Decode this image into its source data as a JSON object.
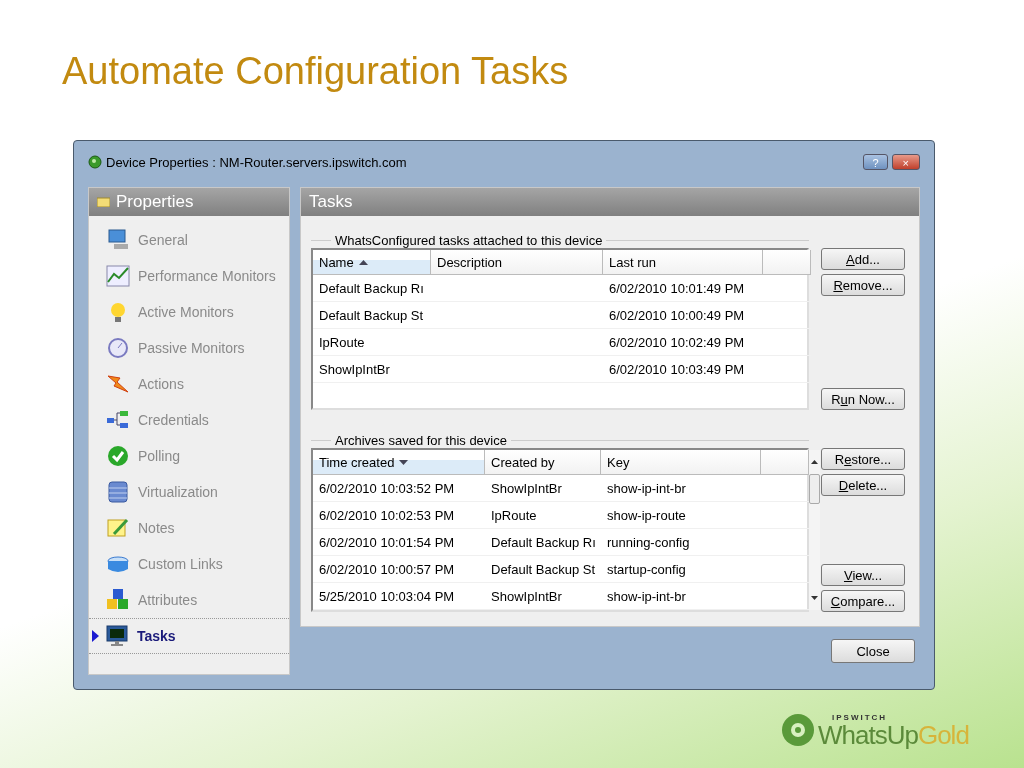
{
  "slide_title": "Automate Configuration Tasks",
  "window": {
    "title": "Device Properties : NM-Router.servers.ipswitch.com",
    "help": "?",
    "close": "×"
  },
  "sidebar": {
    "title": "Properties",
    "items": [
      {
        "label": "General",
        "kind": "computer",
        "selected": false
      },
      {
        "label": "Performance Monitors",
        "kind": "chart",
        "selected": false
      },
      {
        "label": "Active Monitors",
        "kind": "bulb",
        "selected": false
      },
      {
        "label": "Passive Monitors",
        "kind": "dish",
        "selected": false
      },
      {
        "label": "Actions",
        "kind": "bolt",
        "selected": false
      },
      {
        "label": "Credentials",
        "kind": "network",
        "selected": false
      },
      {
        "label": "Polling",
        "kind": "check",
        "selected": false
      },
      {
        "label": "Virtualization",
        "kind": "stack",
        "selected": false
      },
      {
        "label": "Notes",
        "kind": "notes",
        "selected": false
      },
      {
        "label": "Custom Links",
        "kind": "box",
        "selected": false
      },
      {
        "label": "Attributes",
        "kind": "cubes",
        "selected": false
      },
      {
        "label": "Tasks",
        "kind": "monitor",
        "selected": true
      }
    ]
  },
  "panel": {
    "title": "Tasks",
    "tasks": {
      "legend": "WhatsConfigured tasks attached to this device",
      "columns": [
        {
          "label": "Name",
          "sorted": true,
          "descending": false
        },
        {
          "label": "Description",
          "sorted": false
        },
        {
          "label": "Last run",
          "sorted": false
        }
      ],
      "rows": [
        [
          "Default Backup Rı",
          null,
          "6/02/2010 10:01:49 PM"
        ],
        [
          "Default Backup St",
          null,
          "6/02/2010 10:00:49 PM"
        ],
        [
          "IpRoute",
          null,
          "6/02/2010 10:02:49 PM"
        ],
        [
          "ShowIpIntBr",
          null,
          "6/02/2010 10:03:49 PM"
        ]
      ],
      "buttons": [
        {
          "label": {
            "key": "A",
            "after": "dd..."
          },
          "separated": false
        },
        {
          "label": {
            "key": "R",
            "after": "emove..."
          },
          "separated": false
        },
        {
          "label": {
            "before": "R",
            "key": "u",
            "after": "n Now..."
          },
          "separated": true
        }
      ]
    },
    "archives": {
      "legend": "Archives saved for this device",
      "columns": [
        {
          "label": "Time created",
          "sorted": true,
          "descending": true
        },
        {
          "label": "Created by",
          "sorted": false
        },
        {
          "label": "Key",
          "sorted": false
        }
      ],
      "rows": [
        [
          "6/02/2010 10:03:52 PM",
          "ShowIpIntBr",
          "show-ip-int-br"
        ],
        [
          "6/02/2010 10:02:53 PM",
          "IpRoute",
          "show-ip-route"
        ],
        [
          "6/02/2010 10:01:54 PM",
          "Default Backup Rı",
          "running-config"
        ],
        [
          "6/02/2010 10:00:57 PM",
          "Default Backup St",
          "startup-config"
        ],
        [
          "5/25/2010 10:03:04 PM",
          "ShowIpIntBr",
          "show-ip-int-br"
        ]
      ],
      "buttons": [
        {
          "label": {
            "before": "R",
            "key": "e",
            "after": "store..."
          },
          "separated": false
        },
        {
          "label": {
            "key": "D",
            "after": "elete..."
          },
          "separated": false
        },
        {
          "label": {
            "key": "V",
            "after": "iew..."
          },
          "separated": true
        },
        {
          "label": {
            "key": "C",
            "after": "ompare..."
          },
          "separated": false
        }
      ]
    }
  },
  "close_button": "Close",
  "logo": {
    "brand": "IPSWITCH",
    "product": [
      "WhatsUp",
      "Gold"
    ]
  }
}
